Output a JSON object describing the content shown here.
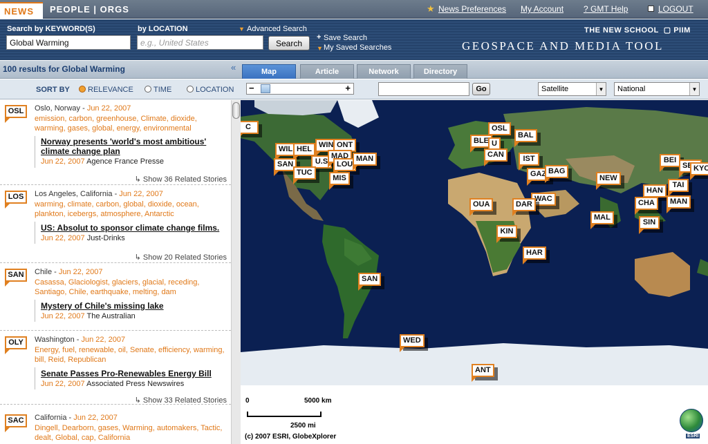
{
  "topnav": {
    "tab_news": "NEWS",
    "tab_people_orgs": "PEOPLE | ORGS",
    "news_preferences": "News Preferences",
    "my_account": "My Account",
    "gmt_help": "? GMT Help",
    "logout": "LOGOUT"
  },
  "search": {
    "keyword_label": "Search by KEYWORD(S)",
    "keyword_value": "Global Warming",
    "location_label": "by LOCATION",
    "location_placeholder": "e.g., United States",
    "advanced_search": "Advanced Search",
    "search_button": "Search",
    "save_search": "Save Search",
    "my_saved_searches": "My Saved Searches"
  },
  "brand": {
    "school": "THE NEW SCHOOL",
    "piim": "PIIM",
    "tool": "GEOSPACE AND MEDIA TOOL"
  },
  "results": {
    "count_text": "100 results for Global Warming",
    "collapse_glyph": "«"
  },
  "view_tabs": [
    "Map",
    "Article",
    "Network",
    "Directory"
  ],
  "sort": {
    "label": "SORT BY",
    "options": [
      "RELEVANCE",
      "TIME",
      "LOCATION"
    ],
    "selected": "RELEVANCE"
  },
  "map_controls": {
    "go_button": "Go",
    "layer_select": "Satellite",
    "scope_select": "National"
  },
  "stories": [
    {
      "code": "OSL",
      "place": "Oslo, Norway",
      "date": "Jun 22, 2007",
      "keywords": "emission, carbon, greenhouse, Climate, dioxide, warming, gases, global, energy, environmental",
      "headline": "Norway presents 'world's most ambitious' climate change plan",
      "source_date": "Jun 22, 2007",
      "source": "Agence France Presse",
      "related": "Show 36 Related Stories"
    },
    {
      "code": "LOS",
      "place": "Los Angeles, California",
      "date": "Jun 22, 2007",
      "keywords": "warming, climate, carbon, global, dioxide, ocean, plankton, icebergs, atmosphere, Antarctic",
      "headline": "US: Absolut to sponsor climate change films.",
      "source_date": "Jun 22, 2007",
      "source": "Just-Drinks",
      "related": "Show 20 Related Stories"
    },
    {
      "code": "SAN",
      "place": "Chile",
      "date": "Jun 22, 2007",
      "keywords": "Casassa, Glaciologist, glaciers, glacial, receding, Santiago, Chile, earthquake, melting, dam",
      "headline": "Mystery of Chile's missing lake",
      "source_date": "Jun 22, 2007",
      "source": "The Australian",
      "related": ""
    },
    {
      "code": "OLY",
      "place": "Washington",
      "date": "Jun 22, 2007",
      "keywords": "Energy, fuel, renewable, oil, Senate, efficiency, warming, bill, Reid, Republican",
      "headline": "Senate Passes Pro-Renewables Energy Bill",
      "source_date": "Jun 22, 2007",
      "source": "Associated Press Newswires",
      "related": "Show 33 Related Stories"
    },
    {
      "code": "SAC",
      "place": "California",
      "date": "Jun 22, 2007",
      "keywords": "Dingell, Dearborn, gases, Warming, automakers, Tactic, dealt, Global, cap, California",
      "headline": "",
      "source_date": "",
      "source": "",
      "related": ""
    }
  ],
  "map_markers": [
    "C",
    "WIL",
    "HEL",
    "WIN",
    "ONT",
    "U.S",
    "MAD",
    "LOU",
    "MAN",
    "SAN",
    "TUC",
    "MIS",
    "OSL",
    "BAL",
    "BLE",
    "U",
    "CAN",
    "IST",
    "GAZ",
    "BAG",
    "WAC",
    "DAR",
    "OUA",
    "KIN",
    "HAR",
    "NEW",
    "MAL",
    "HAN",
    "CHA",
    "SIN",
    "MAN",
    "TAI",
    "BEI",
    "SEO",
    "KYO",
    "SAN",
    "WED",
    "ANT"
  ],
  "map_footer": {
    "scale_km_left": "0",
    "scale_km_right": "5000 km",
    "scale_mi": "2500 mi",
    "copyright": "(c) 2007 ESRI, GlobeXplorer",
    "esri_logo": "ESRI"
  },
  "colors": {
    "accent_orange": "#e07818",
    "nav_bg": "#5f6e82",
    "search_bg": "#2a4870",
    "ocean": "#0a1e4c"
  }
}
